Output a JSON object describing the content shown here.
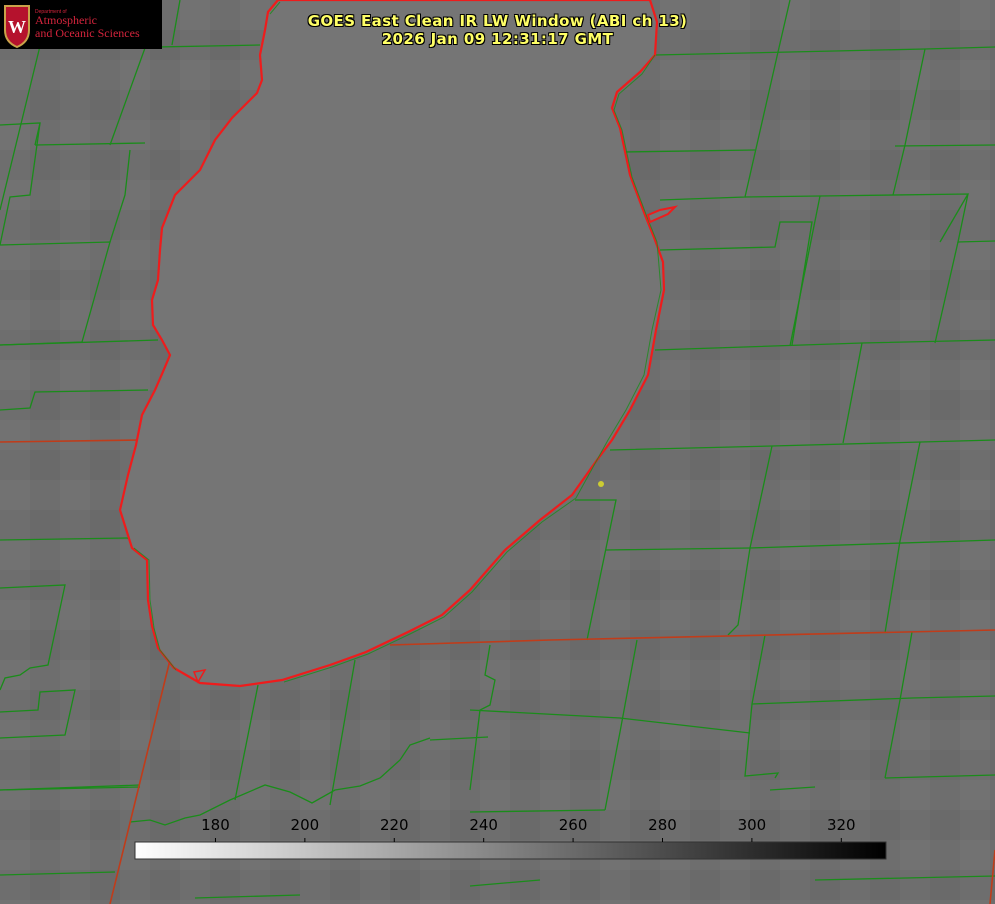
{
  "title": {
    "line1": "GOES East Clean IR LW Window (ABI ch 13)",
    "line2": "2026 Jan 09 12:31:17 GMT"
  },
  "logo": {
    "department": "Department of",
    "line1": "Atmospheric",
    "line2": "and Oceanic Sciences",
    "emblem_letter": "W"
  },
  "colorbar": {
    "ticks": [
      "180",
      "200",
      "220",
      "240",
      "260",
      "280",
      "300",
      "320"
    ],
    "range": [
      162,
      330
    ],
    "gradient": [
      "#ffffff",
      "#000000"
    ]
  },
  "colors": {
    "background": "#6e6e6e",
    "lake": "#757575",
    "boundaries": "#1a8c1a",
    "state_lines": "#c03c1a",
    "coastline": "#ee1c1c",
    "title": "#ffff66",
    "marker": "#cccc33"
  }
}
